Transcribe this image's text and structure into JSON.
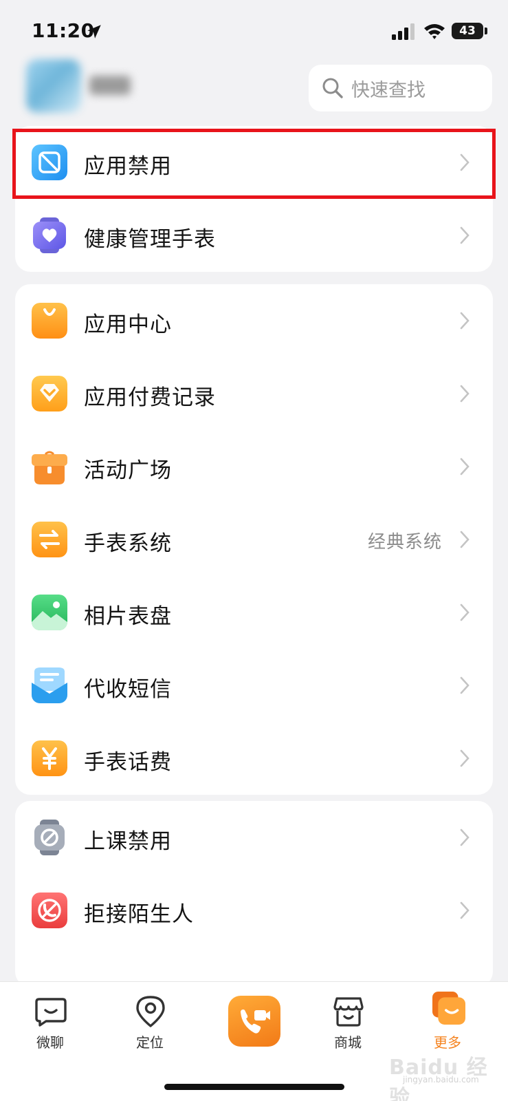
{
  "status_bar": {
    "time": "11:20",
    "battery": "43"
  },
  "header": {
    "search_placeholder": "快速查找"
  },
  "groups": [
    {
      "items": [
        {
          "label": "应用禁用",
          "icon": "app-disable-icon",
          "color": "#2a9df4"
        },
        {
          "label": "健康管理手表",
          "icon": "heart-watch-icon",
          "color": "#7a6ef0"
        }
      ]
    },
    {
      "items": [
        {
          "label": "应用中心",
          "icon": "shopping-bag-icon",
          "color": "#ffa41f"
        },
        {
          "label": "应用付费记录",
          "icon": "diamond-icon",
          "color": "#ffb11f"
        },
        {
          "label": "活动广场",
          "icon": "gift-icon",
          "color": "#f88a2a"
        },
        {
          "label": "手表系统",
          "value": "经典系统",
          "icon": "switch-arrows-icon",
          "color": "#ffa41f"
        },
        {
          "label": "相片表盘",
          "icon": "photo-icon",
          "color": "#33c46a"
        },
        {
          "label": "代收短信",
          "icon": "envelope-icon",
          "color": "#2fa3ef"
        },
        {
          "label": "手表话费",
          "icon": "yen-icon",
          "color": "#ffa41f"
        }
      ]
    },
    {
      "items": [
        {
          "label": "上课禁用",
          "icon": "class-ban-icon",
          "color": "#8e96a4"
        },
        {
          "label": "拒接陌生人",
          "icon": "reject-call-icon",
          "color": "#f25050"
        }
      ]
    }
  ],
  "tabs": [
    {
      "label": "微聊",
      "icon": "chat-icon"
    },
    {
      "label": "定位",
      "icon": "location-pin-icon"
    },
    {
      "label": "",
      "icon": "video-call-icon"
    },
    {
      "label": "商城",
      "icon": "store-icon"
    },
    {
      "label": "更多",
      "icon": "more-icon",
      "active": true
    }
  ],
  "accent_color": "#f5831f",
  "watermark": {
    "text": "Baidu 经验",
    "sub": "jingyan.baidu.com"
  }
}
